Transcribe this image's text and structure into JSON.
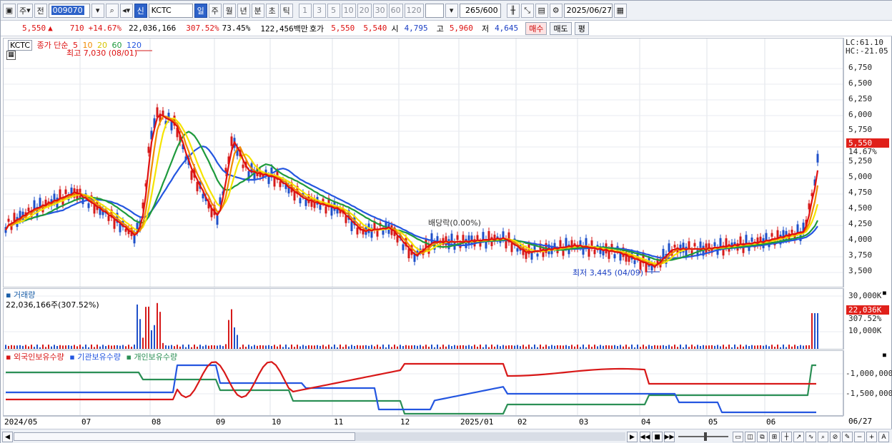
{
  "toolbar": {
    "period": "주",
    "prefix": "전",
    "code": "009070",
    "market_badge": "신",
    "name": "KCTC",
    "tabs": [
      "일",
      "주",
      "월",
      "년",
      "분",
      "초",
      "틱"
    ],
    "active_tab": "일",
    "intervals": [
      "1",
      "3",
      "5",
      "10",
      "20",
      "30",
      "60",
      "120"
    ],
    "count": "265",
    "count_total": "/600",
    "date": "2025/06/27"
  },
  "quote": {
    "price": "5,550",
    "change_arrow": "▲",
    "change": "710",
    "change_pct": "+14.67%",
    "volume": "22,036,166",
    "volume_ratio": "307.52%",
    "turnover_pct": "73.45%",
    "amount": "122,456백만",
    "bid_label": "호가",
    "ask": "5,550",
    "bid": "5,540",
    "open_label": "시",
    "open": "4,795",
    "high_label": "고",
    "high": "5,960",
    "low_label": "저",
    "low": "4,645",
    "buy_button": "매수",
    "sell_button": "매도",
    "eval_button": "평"
  },
  "price_panel": {
    "symbol": "KCTC",
    "ma_label": "종가 단순",
    "ma_periods": [
      "5",
      "10",
      "20",
      "60",
      "120"
    ],
    "ma_colors": [
      "#e01010",
      "#f08a00",
      "#f5e400",
      "#1e9a3c",
      "#2456e0"
    ],
    "high_note": "최고 7,030 (08/01)",
    "low_note": "최저 3,445 (04/09)",
    "dividend_note": "배당락(0.00%)",
    "lc": "LC:61.10",
    "hc": "HC:-21.05",
    "ticks": [
      "6,750",
      "6,500",
      "6,250",
      "6,000",
      "5,750",
      "5,250",
      "5,000",
      "4,750",
      "4,500",
      "4,250",
      "4,000",
      "3,750",
      "3,500"
    ],
    "last_price_tag": "5,550",
    "last_pct_tag": "14.67%"
  },
  "volume_panel": {
    "title": "거래량",
    "value": "22,036,166주(307.52%)",
    "ticks": [
      "30,000K",
      "10,000K"
    ],
    "tag": "22,036K",
    "tag_pct": "307.52%"
  },
  "holding_panel": {
    "series": [
      "외국인보유수량",
      "기관보유수량",
      "개인보유수량"
    ],
    "series_colors": [
      "#d81818",
      "#2456e0",
      "#2b8f55"
    ],
    "ticks": [
      "-1,000,000",
      "-1,500,000"
    ]
  },
  "xaxis": [
    "2024/05",
    "07",
    "08",
    "09",
    "10",
    "11",
    "12",
    "2025/01",
    "02",
    "03",
    "04",
    "05",
    "06",
    "06/27"
  ]
}
